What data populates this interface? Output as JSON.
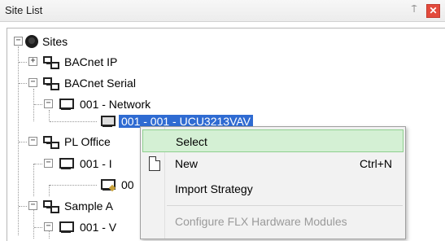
{
  "window": {
    "title": "Site List",
    "pin_glyph": "⍑",
    "close_glyph": "✕"
  },
  "tree": {
    "root": {
      "label": "Sites",
      "icon": "globe-icon",
      "expander": "−"
    },
    "nodes": [
      {
        "label": "BACnet IP",
        "icon": "network-icon",
        "expander": "+"
      },
      {
        "label": "BACnet Serial",
        "icon": "network-icon",
        "expander": "−"
      },
      {
        "label": "001 - Network",
        "icon": "monitor-icon",
        "expander": "−"
      },
      {
        "label": "001 - 001 - UCU3213VAV",
        "icon": "device-icon",
        "selected": true
      },
      {
        "label": "PL Office",
        "icon": "network-icon",
        "expander": "−"
      },
      {
        "label": "001 - I",
        "icon": "monitor-icon",
        "expander": "−"
      },
      {
        "label": "00",
        "icon": "device-edit-icon"
      },
      {
        "label": "Sample A",
        "icon": "network-icon",
        "expander": "−"
      },
      {
        "label": "001 - V",
        "icon": "monitor-icon",
        "expander": "−"
      }
    ]
  },
  "context_menu": {
    "items": [
      {
        "label": "Select",
        "shortcut": "",
        "state": "hover"
      },
      {
        "label": "New",
        "shortcut": "Ctrl+N",
        "state": "normal",
        "icon": "new-document-icon"
      },
      {
        "label": "Import Strategy",
        "shortcut": "",
        "state": "normal"
      },
      {
        "label": "Configure FLX Hardware Modules",
        "shortcut": "",
        "state": "disabled"
      }
    ]
  },
  "colors": {
    "selection": "#2f6bd2",
    "menu_hover": "#d4f0d4",
    "close_button": "#e34a3c"
  }
}
